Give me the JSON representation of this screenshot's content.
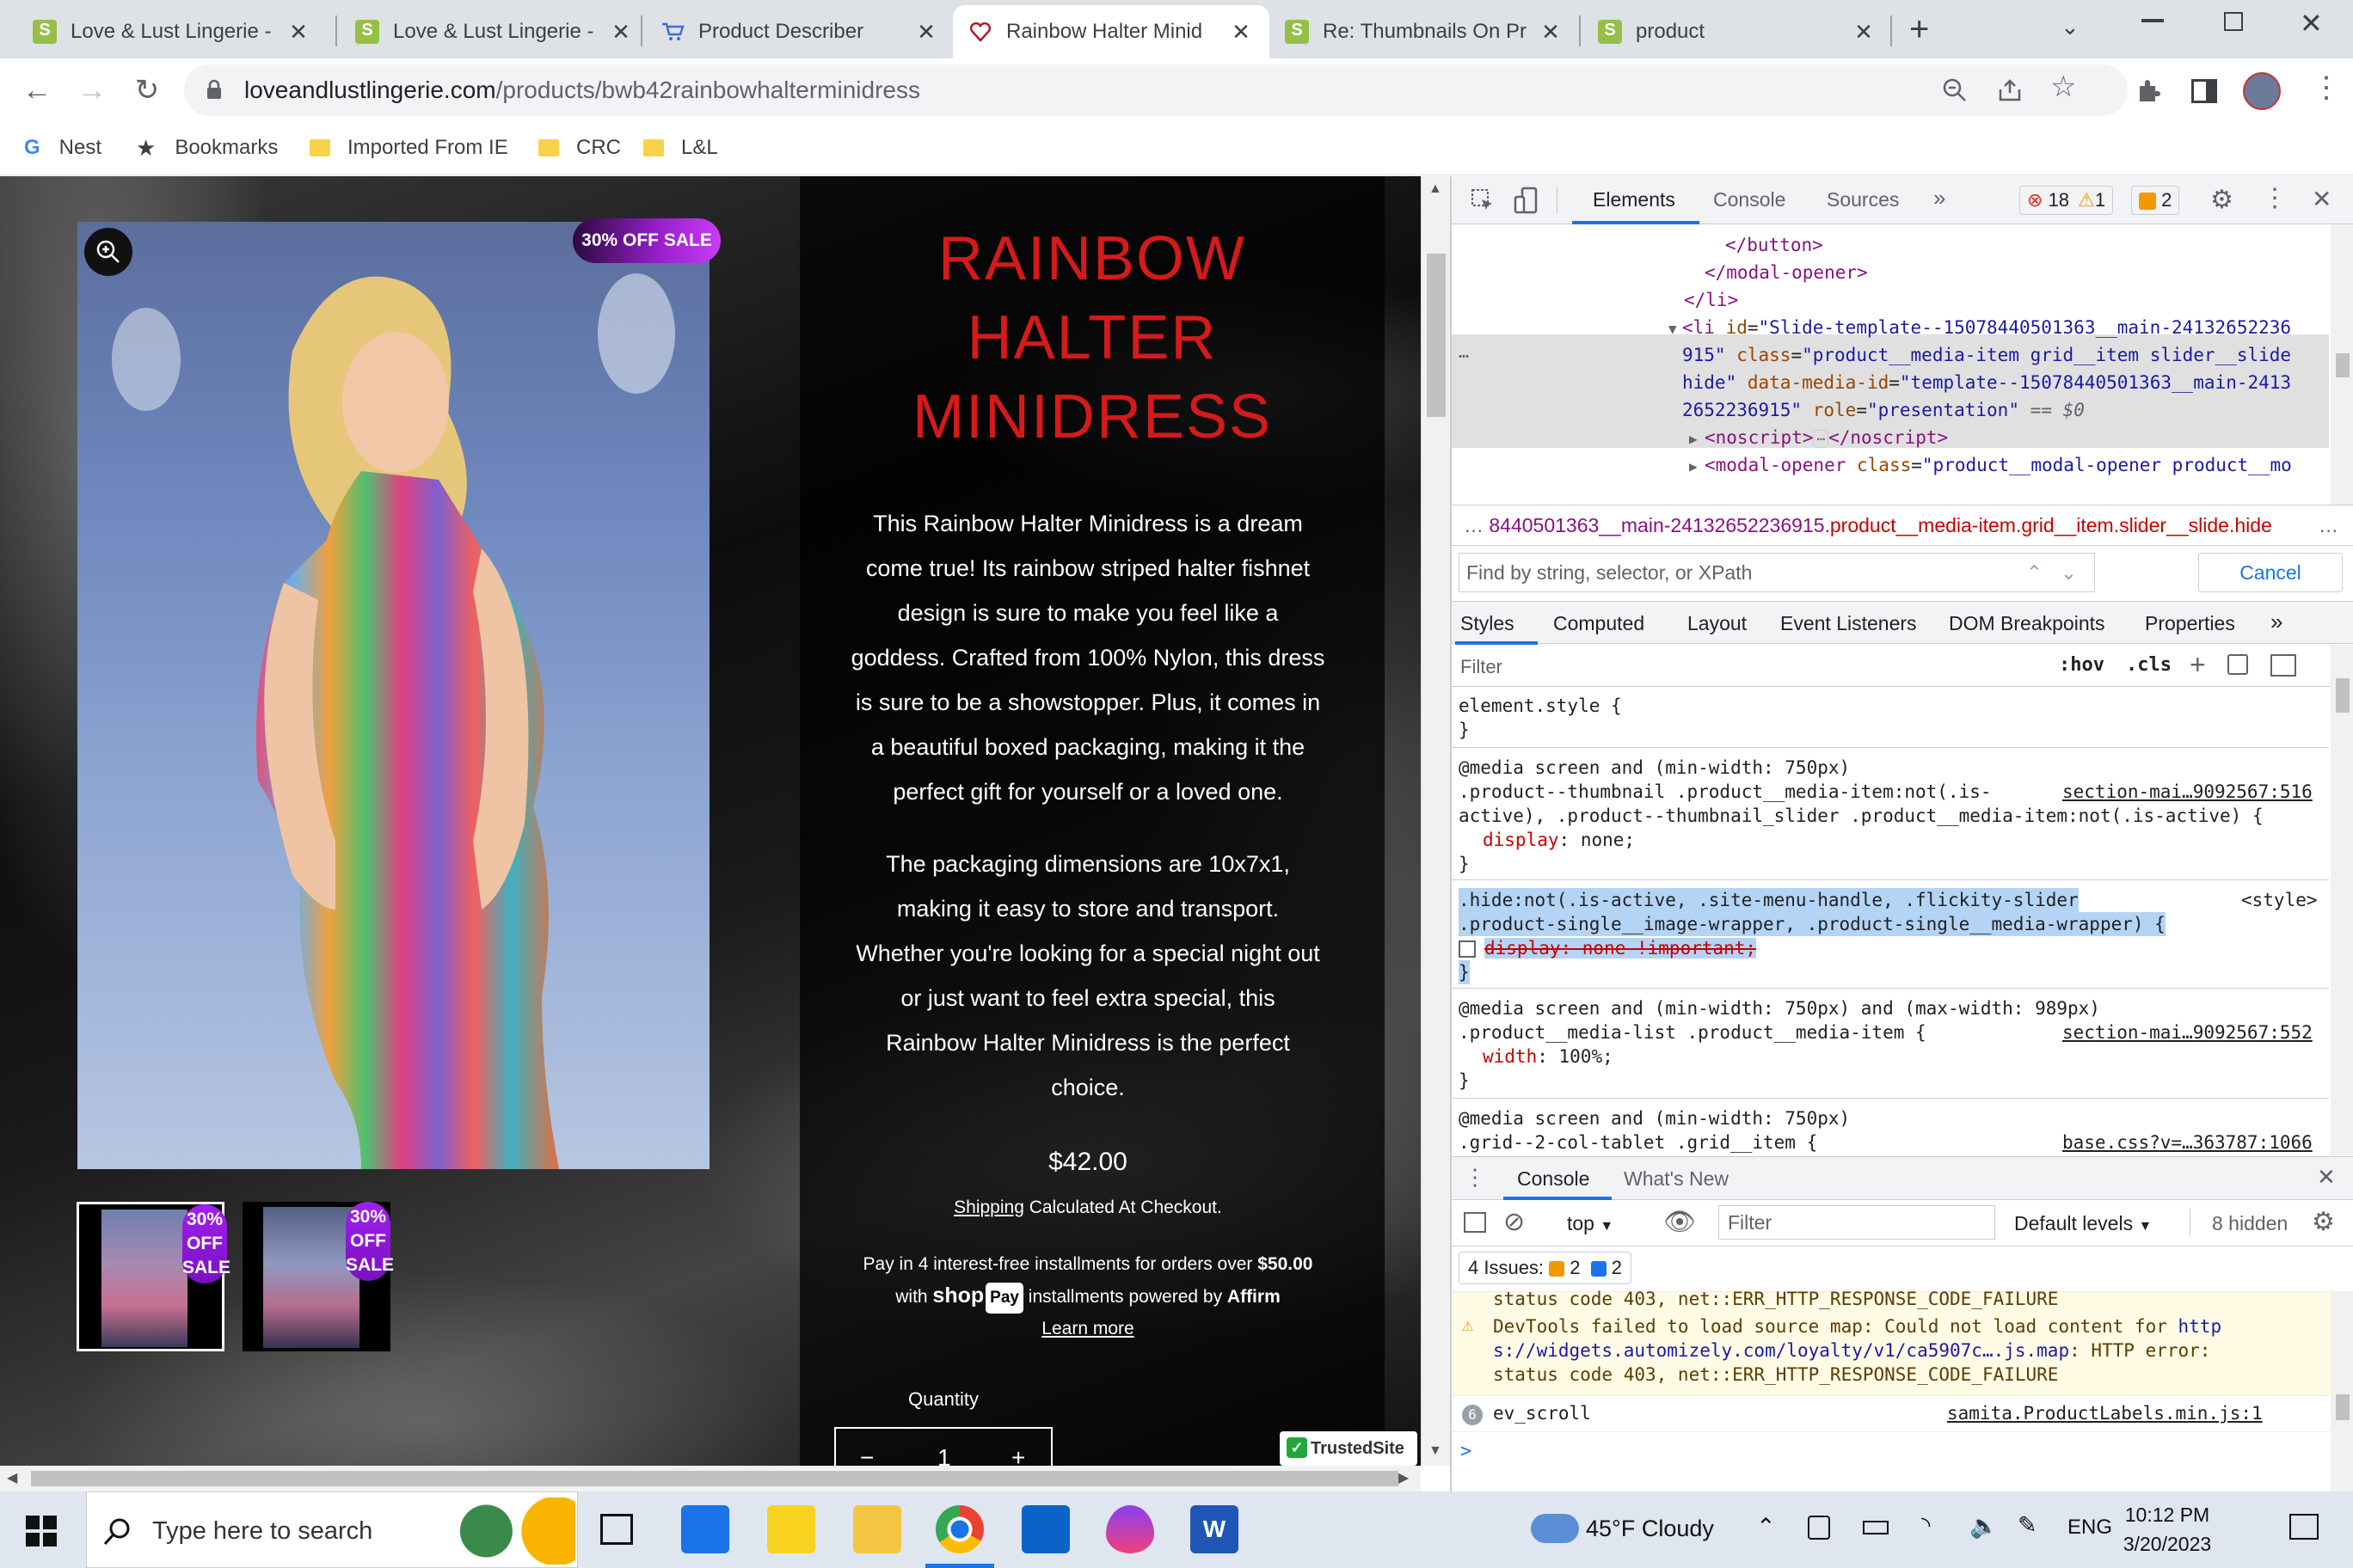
{
  "tabs": [
    {
      "title": "Love & Lust Lingerie -",
      "icon": "shopify-icon"
    },
    {
      "title": "Love & Lust Lingerie -",
      "icon": "shopify-icon"
    },
    {
      "title": "Product Describer",
      "icon": "cart-icon"
    },
    {
      "title": "Rainbow Halter Minid",
      "icon": "heart-icon",
      "active": true
    },
    {
      "title": "Re: Thumbnails On Pr",
      "icon": "shopify-icon"
    },
    {
      "title": "product",
      "icon": "shopify-icon"
    }
  ],
  "address": {
    "host": "loveandlustlingerie.com",
    "path": "/products/bwb42rainbowhalterminidress"
  },
  "bookmarks": [
    "Nest",
    "Bookmarks",
    "Imported From IE",
    "CRC",
    "L&L"
  ],
  "product": {
    "sale_badge": "30% OFF SALE",
    "thumb_badge": [
      "30%",
      "OFF",
      "SALE"
    ],
    "title": [
      "RAINBOW",
      "HALTER",
      "MINIDRESS"
    ],
    "description_1": [
      "This Rainbow Halter Minidress is a dream",
      "come true! Its rainbow striped halter fishnet",
      "design is sure to make you feel like a",
      "goddess. Crafted from 100% Nylon, this dress",
      "is sure to be a showstopper. Plus, it comes in",
      "a beautiful boxed packaging, making it the",
      "perfect gift for yourself or a loved one."
    ],
    "description_2": [
      "The packaging dimensions are 10x7x1,",
      "making it easy to store and transport.",
      "Whether you're looking for a special night out",
      "or just want to feel extra special, this",
      "Rainbow Halter Minidress is the perfect",
      "choice."
    ],
    "price": "$42.00",
    "shipping_link": "Shipping",
    "shipping_rest": " Calculated At Checkout.",
    "affirm_1a": "Pay in 4 interest-free installments for orders over ",
    "affirm_1b": "$50.00",
    "affirm_2a": "with ",
    "shop_label": "shop",
    "pay_label": "Pay",
    "affirm_2b": " installments powered by ",
    "affirm_2c": "Affirm",
    "learn_more": "Learn more",
    "quantity_label": "Quantity",
    "quantity_value": "1",
    "minus": "−",
    "plus": "+",
    "trusted": "TrustedSite"
  },
  "devtools": {
    "tabs": [
      "Elements",
      "Console",
      "Sources"
    ],
    "errors": "18",
    "warnings": "1",
    "issues": "2",
    "dom_lines": [
      "</button>",
      "</modal-opener>",
      "</li>"
    ],
    "li_line_1_pre": "<li ",
    "li_id_attr": "id",
    "li_id_val": "\"Slide-template--15078440501363__main-24132652236",
    "li_line_2": "915\"",
    "li_class_attr": "class",
    "li_class_val": "\"product__media-item grid__item slider__slide",
    "li_line_3a": "hide\"",
    "li_data_attr": "data-media-id",
    "li_data_val": "\"template--15078440501363__main-2413",
    "li_line_4a": "2652236915\"",
    "li_role_attr": "role",
    "li_role_val": "\"presentation\"",
    "li_eq": "== $0",
    "noscript": "<noscript>",
    "noscript_close": "</noscript>",
    "modal_open": "<modal-opener ",
    "modal_class_attr": "class",
    "modal_class_val": "\"product__modal-opener product__mo",
    "breadcrumb_pre": "…",
    "breadcrumb_mid": "8440501363__main-24132652236915",
    "breadcrumb_cls": ".product__media-item.grid__item.slider__slide.hide",
    "find_placeholder": "Find by string, selector, or XPath",
    "cancel": "Cancel",
    "style_tabs": [
      "Styles",
      "Computed",
      "Layout",
      "Event Listeners",
      "DOM Breakpoints",
      "Properties"
    ],
    "style_filter": "Filter",
    "hov": ":hov",
    "cls": ".cls",
    "rules": {
      "element_style": "element.style {",
      "close": "}",
      "r1_media": "@media screen and (min-width: 750px)",
      "r1_sel_a": ".product--thumbnail .product__media-item:not(.is-",
      "r1_sel_b": "active), .product--thumbnail_slider .product__media-item:not(.is-active) {",
      "r1_src": "section-mai…9092567:516",
      "r1_prop": "display",
      "r1_val": "none;",
      "r2_sel_a": ".hide:not(.is-active, .site-menu-handle, .flickity-slider",
      "r2_sel_b": ".product-single__image-wrapper, .product-single__media-wrapper) {",
      "r2_src": "<style>",
      "r2_decl": "display: none !important;",
      "r3_media": "@media screen and (min-width: 750px) and (max-width: 989px)",
      "r3_sel": ".product__media-list .product__media-item {",
      "r3_src": "section-mai…9092567:552",
      "r3_prop": "width",
      "r3_val": "100%;",
      "r4_media": "@media screen and (min-width: 750px)",
      "r4_sel": ".grid--2-col-tablet .grid__item {",
      "r4_src": "base.css?v=…363787:1066"
    },
    "drawer_tabs": [
      "Console",
      "What's New"
    ],
    "context": "top",
    "con_filter": "Filter",
    "levels": "Default levels",
    "hidden": "8 hidden",
    "issues_label": "4 Issues:",
    "issues_warn": "2",
    "issues_info": "2",
    "warn_line_0": "status code 403, net::ERR_HTTP_RESPONSE_CODE_FAILURE",
    "warn_line_1a": "DevTools failed to load source map: Could not load content for ",
    "warn_link_1": "http",
    "warn_link_2": "s://widgets.automizely.com/loyalty/v1/ca5907c….js.map",
    "warn_line_2b": ": HTTP error:",
    "warn_line_3": "status code 403, net::ERR_HTTP_RESPONSE_CODE_FAILURE",
    "ev_count": "6",
    "ev_text": "ev_scroll",
    "ev_src": "samita.ProductLabels.min.js:1",
    "prompt": ">"
  },
  "taskbar": {
    "search_placeholder": "Type here to search",
    "weather": "45°F  Cloudy",
    "lang": "ENG",
    "time": "10:12 PM",
    "date": "3/20/2023"
  }
}
